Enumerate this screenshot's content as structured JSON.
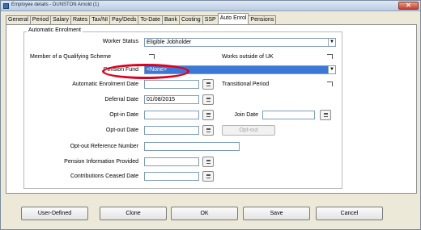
{
  "window": {
    "title": "Employee details - DUNSTON Arnold (1)"
  },
  "tabs": [
    {
      "label": "General"
    },
    {
      "label": "Period"
    },
    {
      "label": "Salary"
    },
    {
      "label": "Rates"
    },
    {
      "label": "Tax/NI"
    },
    {
      "label": "Pay/Deds"
    },
    {
      "label": "To-Date"
    },
    {
      "label": "Bank"
    },
    {
      "label": "Costing"
    },
    {
      "label": "SSP"
    },
    {
      "label": "Auto Enrol"
    },
    {
      "label": "Pensions"
    }
  ],
  "group": {
    "legend": "Automatic Enrolment"
  },
  "fields": {
    "worker_status": {
      "label": "Worker Status",
      "value": "Eligible Jobholder"
    },
    "qualifying_scheme": {
      "label": "Member of a Qualifying Scheme"
    },
    "outside_uk": {
      "label": "Works outside of UK"
    },
    "pension_fund": {
      "label": "Pension Fund",
      "value": "<None>"
    },
    "ae_date": {
      "label": "Automatic Enrolment Date",
      "value": ""
    },
    "transitional": {
      "label": "Transitional Period"
    },
    "deferral_date": {
      "label": "Deferral Date",
      "value": "01/08/2015"
    },
    "optin_date": {
      "label": "Opt-in Date",
      "value": ""
    },
    "join_date": {
      "label": "Join Date",
      "value": ""
    },
    "optout_date": {
      "label": "Opt-out Date",
      "value": ""
    },
    "optout_button": "Opt-out",
    "optout_ref": {
      "label": "Opt-out Reference Number",
      "value": ""
    },
    "pension_info": {
      "label": "Pension Information Provided",
      "value": ""
    },
    "contrib_ceased": {
      "label": "Contributions Ceased Date",
      "value": ""
    }
  },
  "footer": {
    "user_defined": "User-Defined",
    "clone": "Clone",
    "ok": "OK",
    "save": "Save",
    "cancel": "Cancel"
  }
}
